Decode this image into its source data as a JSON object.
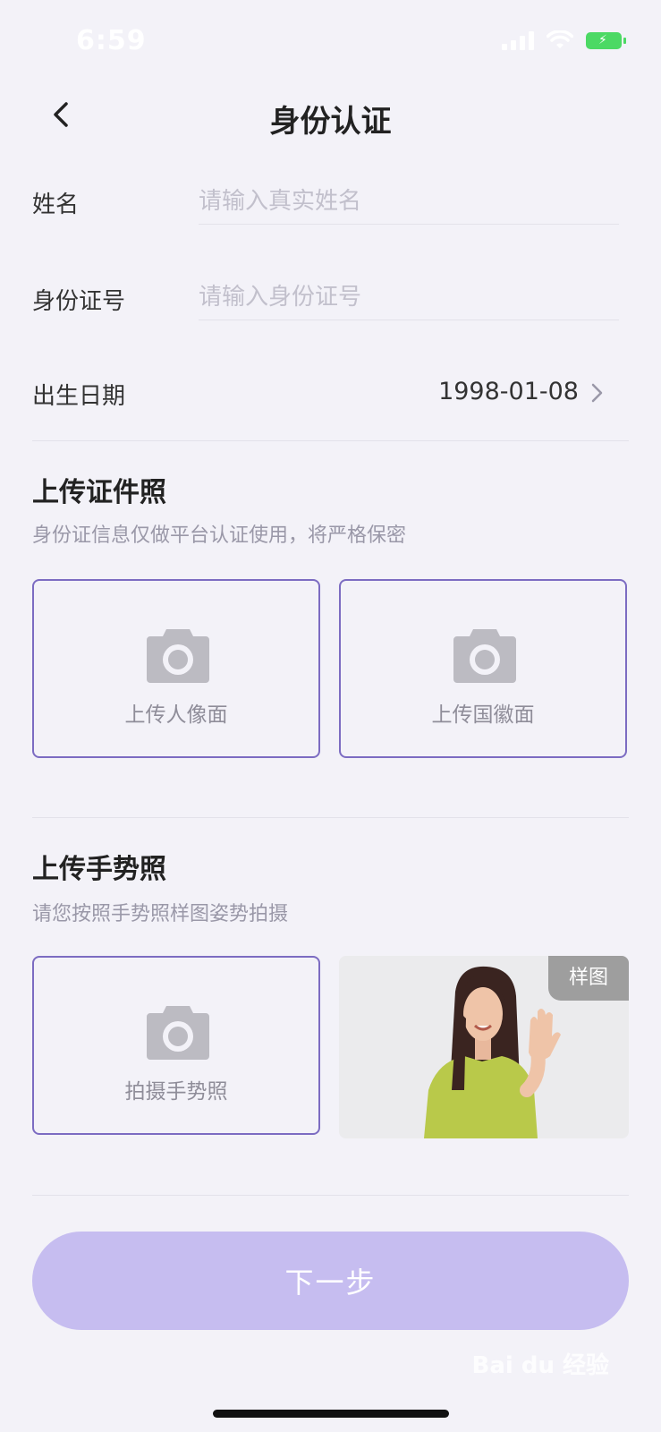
{
  "status_bar": {
    "time": "6:59"
  },
  "header": {
    "title": "身份认证"
  },
  "form": {
    "name": {
      "label": "姓名",
      "placeholder": "请输入真实姓名",
      "value": ""
    },
    "id_number": {
      "label": "身份证号",
      "placeholder": "请输入身份证号",
      "value": ""
    },
    "birth_date": {
      "label": "出生日期",
      "value": "1998-01-08"
    }
  },
  "id_photo_section": {
    "title": "上传证件照",
    "subtitle": "身份证信息仅做平台认证使用，将严格保密",
    "front_label": "上传人像面",
    "back_label": "上传国徽面"
  },
  "gesture_section": {
    "title": "上传手势照",
    "subtitle": "请您按照手势照样图姿势拍摄",
    "capture_label": "拍摄手势照",
    "sample_badge": "样图"
  },
  "next_button": {
    "label": "下一步"
  },
  "watermark": "Bai du 经验",
  "colors": {
    "accent": "#7c6cc2",
    "button": "#c6bdf0",
    "background": "#f3f2f8"
  }
}
